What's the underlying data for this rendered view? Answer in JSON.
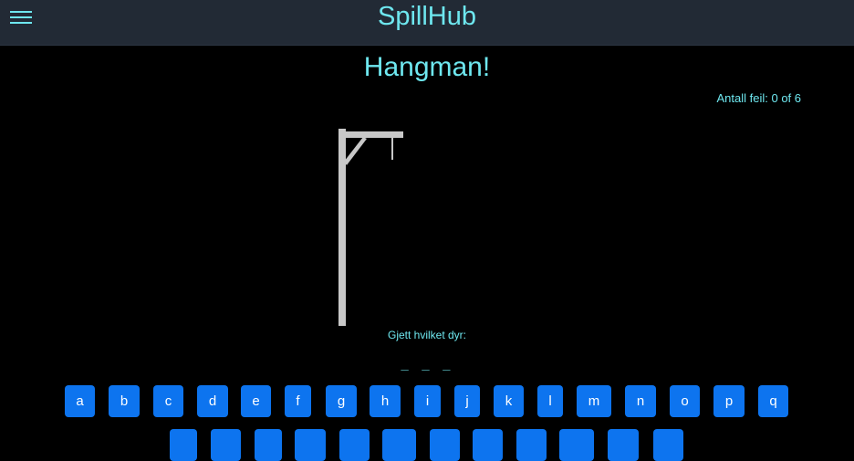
{
  "header": {
    "brand": "SpillHub",
    "menu_icon": "hamburger-menu-icon"
  },
  "game": {
    "title": "Hangman!",
    "errors_text": "Antall feil: 0 of 6",
    "errors_count": 0,
    "errors_max": 6,
    "hint": "Gjett hvilket dyr:",
    "word_display": "_ _ _"
  },
  "colors": {
    "accent": "#6ee7ef",
    "key_background": "#0d74ef",
    "navbar": "#222a35",
    "background": "#000000",
    "gallows": "#c8c8c8"
  },
  "keyboard": {
    "row1": [
      "a",
      "b",
      "c",
      "d",
      "e",
      "f",
      "g",
      "h",
      "i",
      "j",
      "k",
      "l",
      "m",
      "n",
      "o",
      "p",
      "q"
    ],
    "row2": [
      "",
      "",
      "",
      "",
      "",
      "",
      "",
      "",
      "",
      "",
      "",
      ""
    ]
  }
}
